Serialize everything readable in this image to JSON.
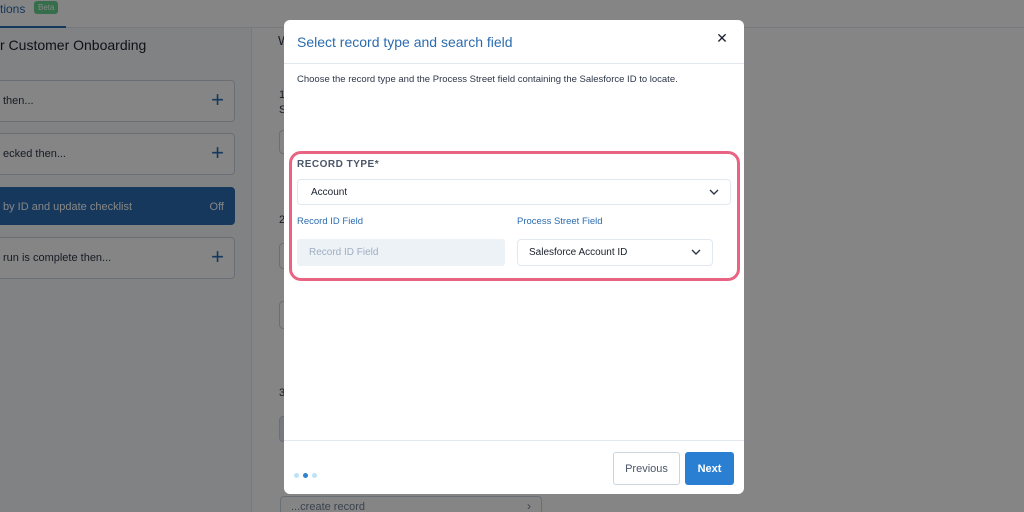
{
  "background": {
    "tab_label": "tions",
    "beta_badge": "Beta",
    "flow_title": "r Customer Onboarding",
    "rules": [
      {
        "text": "then...",
        "action": "+"
      },
      {
        "text": "ecked then...",
        "action": "+"
      },
      {
        "text": "by ID and update checklist",
        "status": "Off"
      },
      {
        "text": "run is complete then...",
        "action": "+"
      }
    ],
    "steps": [
      "1",
      "2",
      "3"
    ],
    "step_heading": "W",
    "step_sub": "S",
    "create_record_label": "...create record"
  },
  "modal": {
    "title": "Select record type and search field",
    "close_symbol": "✕",
    "instructions": "Choose the record type and the Process Street field containing the Salesforce ID to locate.",
    "record_type": {
      "label": "RECORD TYPE*",
      "value": "Account"
    },
    "record_id_field": {
      "label": "Record ID Field",
      "placeholder": "Record ID Field",
      "value": ""
    },
    "process_street_field": {
      "label": "Process Street Field",
      "value": "Salesforce Account ID"
    },
    "pagination": {
      "total": 3,
      "current": 2
    },
    "previous_label": "Previous",
    "next_label": "Next"
  },
  "colors": {
    "accent": "#2b6cb0",
    "primary_button": "#2b7fd3",
    "highlight_border": "#e96482"
  }
}
